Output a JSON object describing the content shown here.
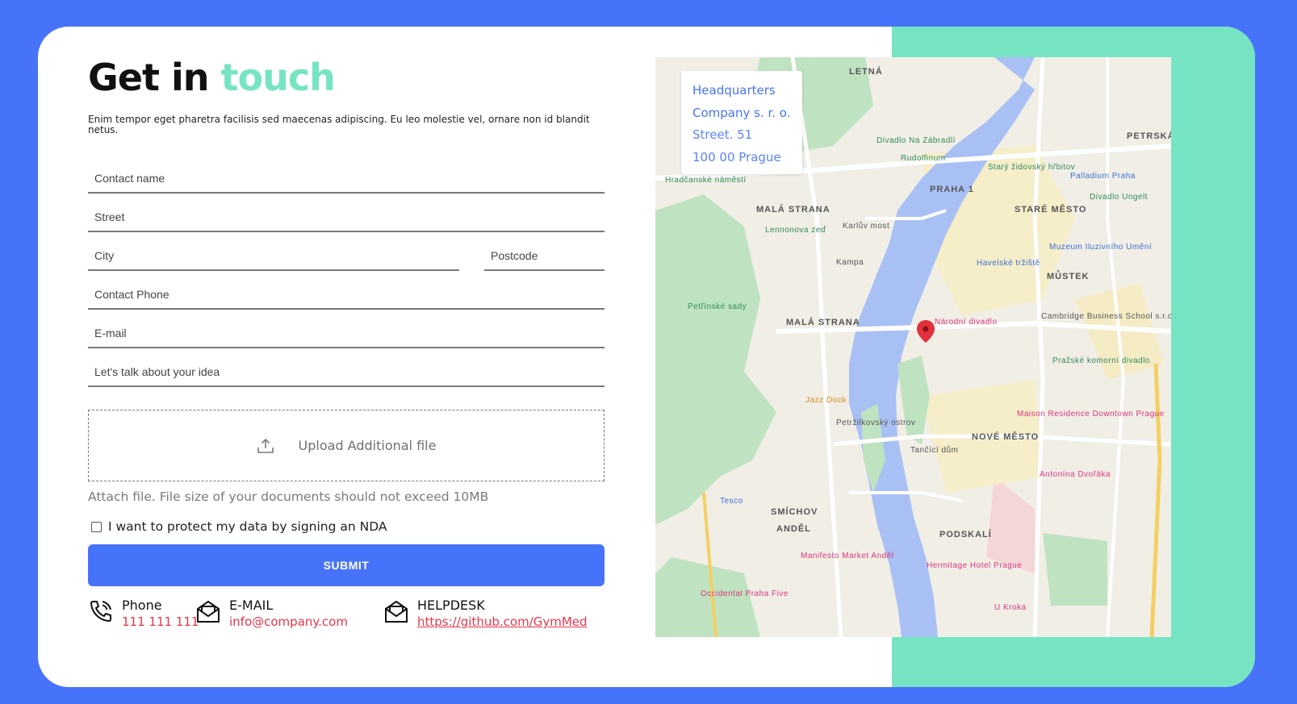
{
  "page": {
    "title_part1": "Get in",
    "title_part2": "touch",
    "subtitle": "Enim tempor eget pharetra facilisis sed maecenas adipiscing. Eu leo molestie vel, ornare non id blandit netus."
  },
  "form": {
    "contact_name_placeholder": "Contact name",
    "street_placeholder": "Street",
    "city_placeholder": "City",
    "postcode_placeholder": "Postcode",
    "phone_placeholder": "Contact Phone",
    "email_placeholder": "E-mail",
    "idea_placeholder": "Let's talk about your idea",
    "upload_label": "Upload Additional file",
    "upload_hint": "Attach file. File size of your documents should not exceed 10MB",
    "nda_label": "I want to protect my data by signing an NDA",
    "nda_checked": false,
    "submit_label": "SUBMIT"
  },
  "contacts": [
    {
      "title": "Phone",
      "value": "111 111 111",
      "icon": "phone-icon"
    },
    {
      "title": "E-MAIL",
      "value": "info@company.com",
      "icon": "mail-icon"
    },
    {
      "title": "HELPDESK",
      "value": "https://github.com/GymMed",
      "icon": "mail-icon"
    }
  ],
  "map": {
    "hq_line1": "Headquarters",
    "hq_line2": "Company s. r. o.",
    "hq_line3": "Street. 51",
    "hq_line4": "100 00 Prague",
    "labels": {
      "letna": "LETNÁ",
      "praha1": "PRAHA 1",
      "mala_strana": "MALÁ STRANA",
      "mala_strana2": "MALÁ STRANA",
      "stare_mesto": "STARÉ MĚSTO",
      "mustek": "MŮSTEK",
      "nove_mesto": "NOVÉ MĚSTO",
      "smichov": "SMÍCHOV",
      "andel": "ANDĚL",
      "podskali": "PODSKALÍ",
      "petrska": "PETRSKÁ",
      "kampa": "Kampa",
      "narodni_divadlo": "Národní divadlo",
      "divadlo_na_zabradli": "Divadlo Na Zábradlí",
      "jazz_dock": "Jazz Dock",
      "tancici_dum": "Tančící dům",
      "petrin": "Petřínské sady",
      "rudolfinum": "Rudolfinum",
      "zidovsky": "Starý židovský hřbitov",
      "palladium": "Palladium Praha",
      "hradcanske": "Hradčanské náměstí",
      "lennonova": "Lennonova zeď",
      "karluv_most": "Karlův most",
      "muzeum": "Muzeum Iluzivního Umění",
      "havelske": "Havelské tržiště",
      "cambridge": "Cambridge Business School s.r.o.",
      "maison": "Maison Residence Downtown Prague",
      "antonina": "Antonína Dvořáka",
      "hermitage": "Hermitage Hotel Prague",
      "manifesto": "Manifesto Market Anděl",
      "tesco": "Tesco",
      "occidental": "Occidental Praha Five",
      "u_kroka": "U Kroka",
      "divadlo_ungelt": "Divadlo Ungelt",
      "petrzilkovsky": "Petržilkovský ostrov",
      "prazske_komorni": "Pražské komorní divadlo"
    },
    "water_color": "#a9c0f5",
    "park_color": "#bfe3c1",
    "pin_color": "#e0313c"
  },
  "colors": {
    "background": "#4773fa",
    "accent": "#76e4c3",
    "link": "#e8354a"
  }
}
